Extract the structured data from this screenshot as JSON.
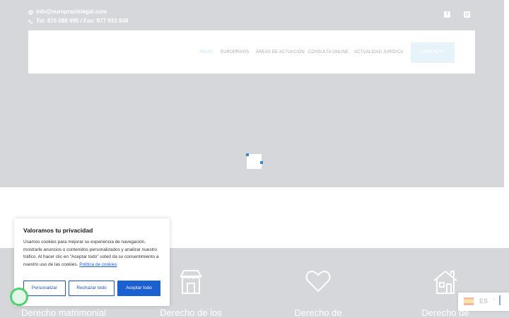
{
  "topbar": {
    "email": "info@europraxislegal.com",
    "phone": "Tel: 670 088 995 / Fax: 977 933 848",
    "social": [
      {
        "icon": "facebook-icon",
        "glyph": "f"
      },
      {
        "icon": "instagram-icon",
        "glyph": "◎"
      }
    ]
  },
  "nav": {
    "items": [
      "INICIO",
      "EUROPRAXIS",
      "ÁREAS DE ACTUACIÓN",
      "CONSULTA ONLINE",
      "ACTUALIDAD JURÍDICA"
    ],
    "cta": "CONTACTO"
  },
  "services": [
    {
      "label": "Derecho matrimonial",
      "icon": "rings-icon"
    },
    {
      "label": "Derecho de los",
      "icon": "store-icon"
    },
    {
      "label": "Derecho de",
      "icon": "heart-icon"
    },
    {
      "label": "Derecho de",
      "icon": "house-icon"
    }
  ],
  "cookie": {
    "title": "Valoramos tu privacidad",
    "text": "Usamos cookies para mejorar su experiencia de navegación, mostrarle anuncios o contenidos personalizados y analizar nuestro tráfico. Al hacer clic en \"Aceptar todo\" usted da su consentimiento a nuestro uso de las cookies.",
    "link": "Política de cookies",
    "customize": "Personalizar",
    "reject": "Rechazar todo",
    "accept": "Aceptar todo"
  },
  "language": {
    "code": "ES",
    "caret": "⌃"
  },
  "colors": {
    "hero": "#d6d7da",
    "accent": "#1c5fd0",
    "navActive": "#bfe7f2"
  }
}
